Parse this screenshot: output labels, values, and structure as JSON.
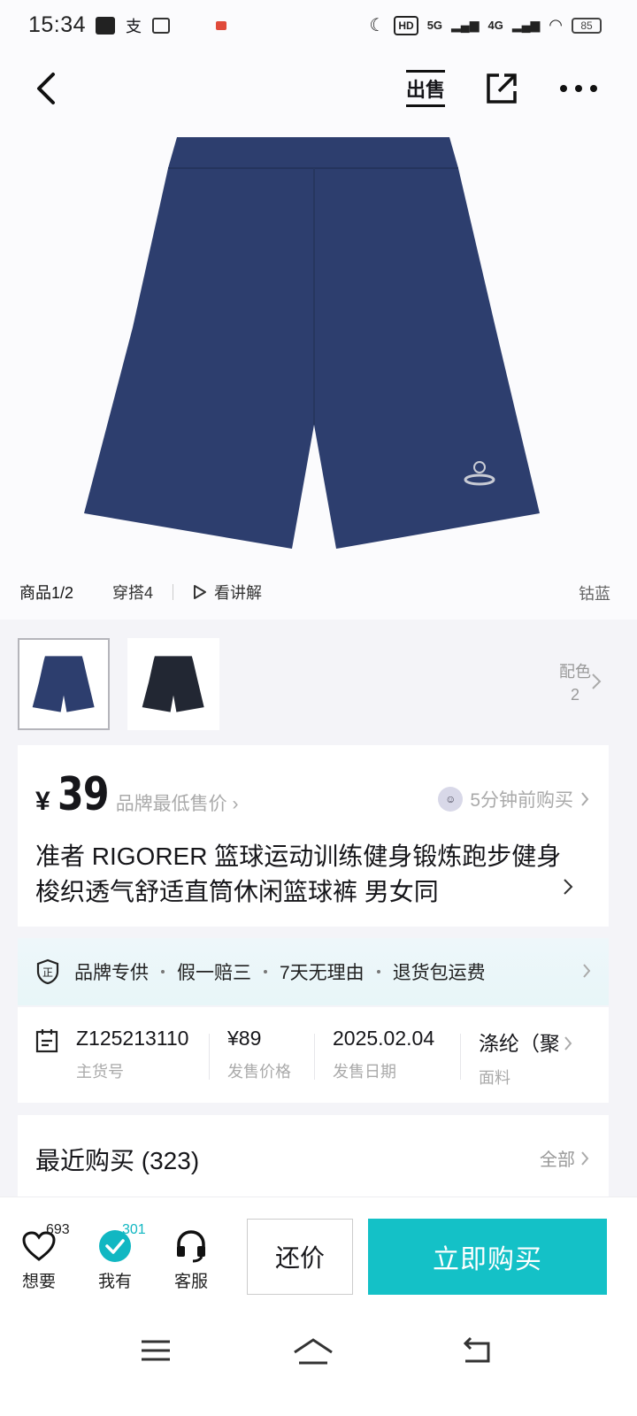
{
  "status_bar": {
    "time": "15:34",
    "hd_label": "HD",
    "net1": "5G",
    "net2": "4G",
    "battery": "85"
  },
  "header": {
    "sell_label": "出售"
  },
  "gallery": {
    "tabs": [
      "商品1/2",
      "穿搭4"
    ],
    "video_label": "看讲解",
    "color_name": "钴蓝",
    "shorts_color": "#2d3e6e",
    "thumb2_color": "#222733"
  },
  "variants": {
    "label": "配色",
    "count": "2"
  },
  "price": {
    "currency": "¥",
    "value": "39",
    "note": "品牌最低售价",
    "recent_buy": "5分钟前购买"
  },
  "product": {
    "title": "准者 RIGORER 篮球运动训练健身锻炼跑步健身 梭织透气舒适直筒休闲篮球裤 男女同"
  },
  "services": [
    "品牌专供",
    "假一赔三",
    "7天无理由",
    "退货包运费"
  ],
  "specs": [
    {
      "value": "Z125213110",
      "label": "主货号"
    },
    {
      "value": "¥89",
      "label": "发售价格"
    },
    {
      "value": "2025.02.04",
      "label": "发售日期"
    },
    {
      "value": "涤纶（聚",
      "label": "面料"
    }
  ],
  "recent": {
    "title": "最近购买 (323)",
    "all_label": "全部"
  },
  "bottom": {
    "want_label": "想要",
    "want_count": "693",
    "own_label": "我有",
    "own_count": "301",
    "service_label": "客服",
    "bargain_label": "还价",
    "buy_label": "立即购买"
  },
  "colors": {
    "accent": "#14c1c7",
    "own_badge": "#11b7c2"
  }
}
